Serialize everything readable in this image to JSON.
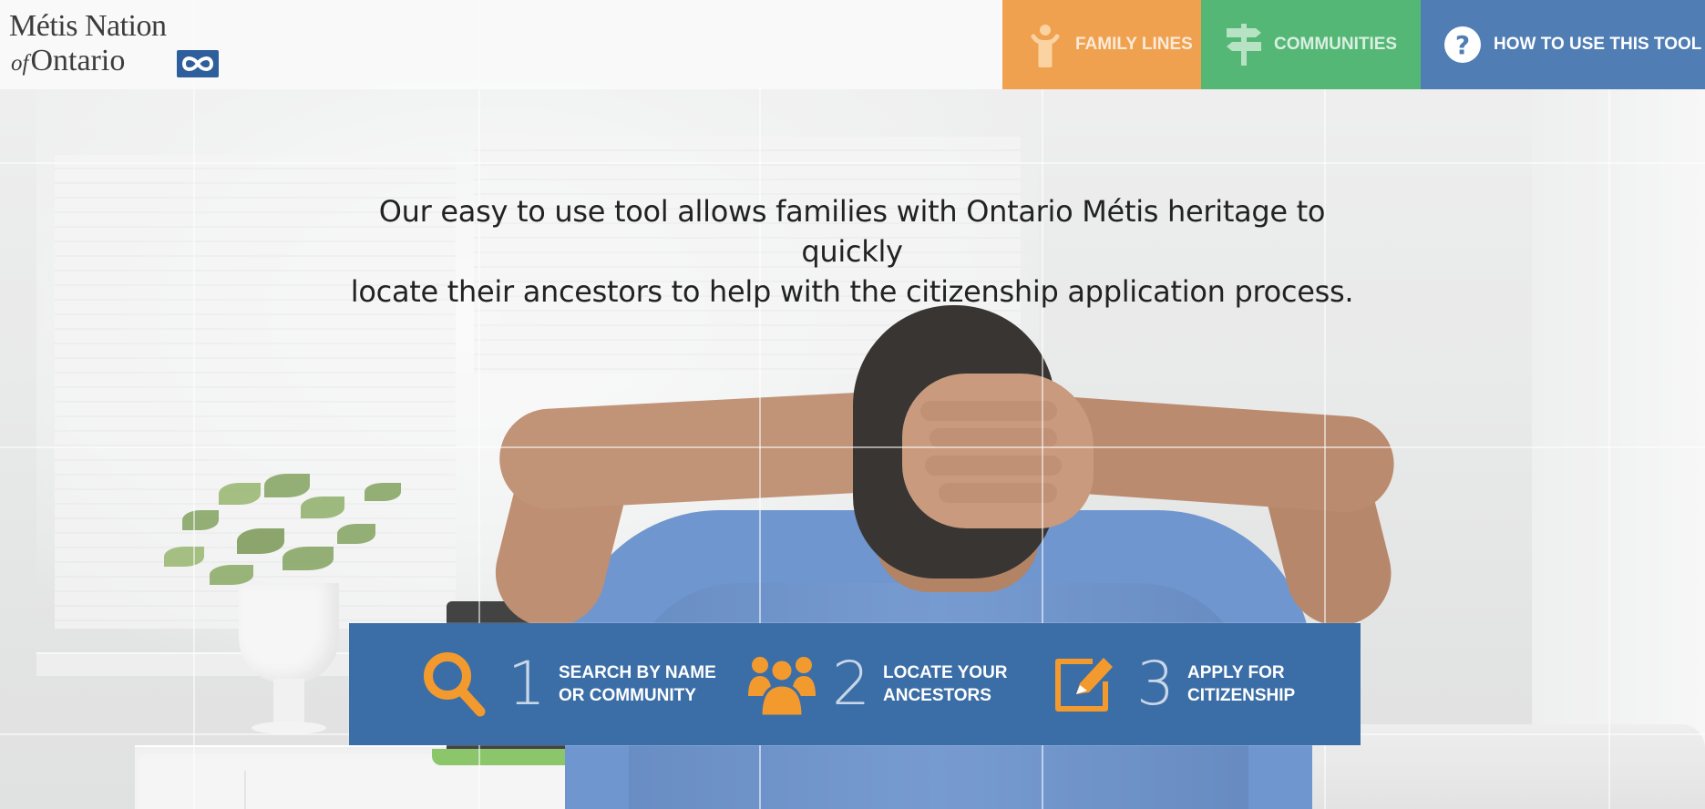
{
  "logo": {
    "line1": "Métis Nation",
    "of": "of",
    "line2": "Ontario",
    "mark_icon": "infinity-icon"
  },
  "nav": {
    "family_lines": {
      "label": "FAMILY LINES",
      "icon": "person-icon",
      "color": "#f0a14f"
    },
    "communities": {
      "label": "COMMUNITIES",
      "icon": "signpost-icon",
      "color": "#55b776"
    },
    "how_to": {
      "label": "HOW TO USE THIS TOOL",
      "icon": "question-circle-icon",
      "color": "#4f7db4"
    }
  },
  "intro": {
    "line1": "Our easy to use tool allows families with Ontario Métis heritage to quickly",
    "line2": "locate their ancestors to help with the citizenship application process."
  },
  "steps": [
    {
      "number": "1",
      "line1": "SEARCH BY NAME",
      "line2": "OR COMMUNITY",
      "icon": "search-icon"
    },
    {
      "number": "2",
      "line1": "LOCATE YOUR",
      "line2": "ANCESTORS",
      "icon": "people-group-icon"
    },
    {
      "number": "3",
      "line1": "APPLY FOR",
      "line2": "CITIZENSHIP",
      "icon": "edit-form-icon"
    }
  ],
  "colors": {
    "accent_orange": "#f39a2e",
    "steps_bar": "#3b6ea6",
    "text_dark": "#222222"
  }
}
